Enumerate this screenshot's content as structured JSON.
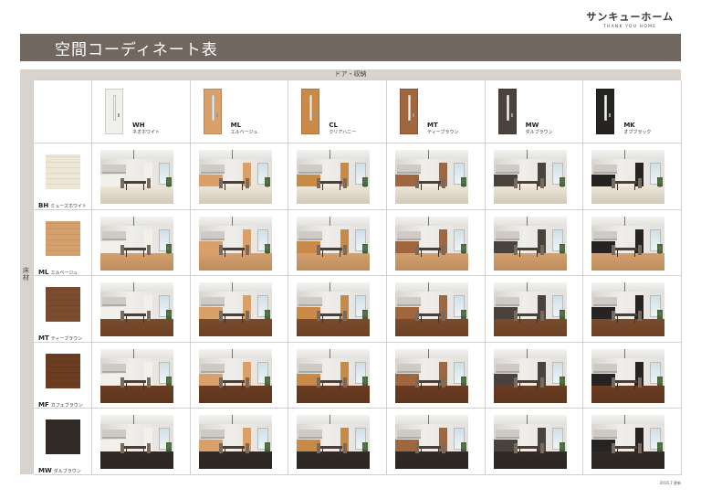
{
  "brand": {
    "name": "サンキューホーム",
    "tagline": "THANK YOU HOME"
  },
  "title": "空間コーディネート表",
  "door_axis_label": "ドア・収納",
  "floor_axis_label": "床材",
  "doors": [
    {
      "code": "WH",
      "name": "ネオホワイト",
      "color": "#f2f0ea"
    },
    {
      "code": "ML",
      "name": "エルベージュ",
      "color": "#d9a06a"
    },
    {
      "code": "CL",
      "name": "クリアハニー",
      "color": "#c98a48"
    },
    {
      "code": "MT",
      "name": "ティーブラウン",
      "color": "#a0663e"
    },
    {
      "code": "MW",
      "name": "ダルブラウン",
      "color": "#4a423c"
    },
    {
      "code": "MK",
      "name": "オブブラック",
      "color": "#262422"
    }
  ],
  "floors": [
    {
      "code": "BH",
      "name": "ミューズホワイト",
      "color": "#ede5d6"
    },
    {
      "code": "ML",
      "name": "エルベージュ",
      "color": "#d5a06c"
    },
    {
      "code": "MT",
      "name": "ティーブラウン",
      "color": "#7a4b2c"
    },
    {
      "code": "MF",
      "name": "カフェブラウン",
      "color": "#6a3c22"
    },
    {
      "code": "MW",
      "name": "ダルブラウン",
      "color": "#322a25"
    }
  ],
  "footnote": "2016.7 更新"
}
